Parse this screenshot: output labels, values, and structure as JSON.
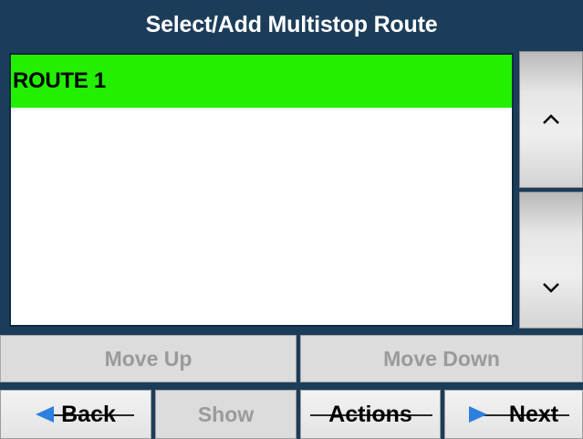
{
  "header": {
    "title": "Select/Add Multistop Route"
  },
  "routes": {
    "items": [
      {
        "label": "ROUTE 1",
        "selected": true
      }
    ],
    "selected_color": "#22f000"
  },
  "scroll": {
    "up_icon": "chevron-up-icon",
    "down_icon": "chevron-down-icon"
  },
  "reorder": {
    "move_up_label": "Move Up",
    "move_down_label": "Move Down"
  },
  "nav": {
    "back_label": "Back",
    "show_label": "Show",
    "actions_label": "Actions",
    "next_label": "Next",
    "arrow_color": "#2d7fe0"
  },
  "colors": {
    "background": "#1c3d5a",
    "disabled_text": "#9a9a9a"
  }
}
